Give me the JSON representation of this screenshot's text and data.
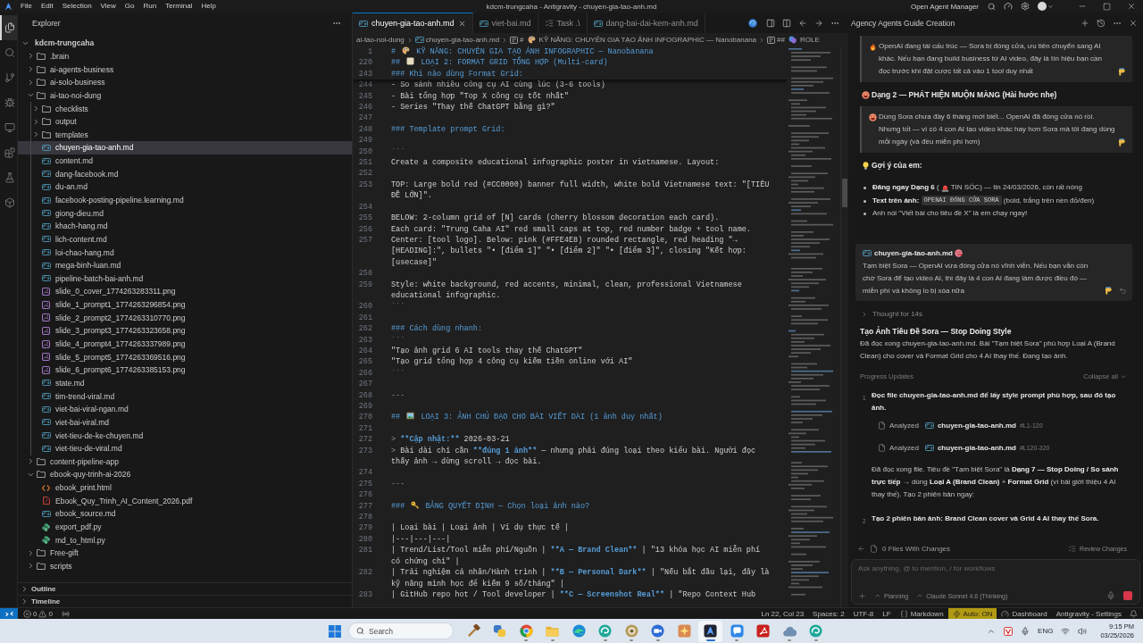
{
  "title_bar": {
    "menu": [
      "File",
      "Edit",
      "Selection",
      "View",
      "Go",
      "Run",
      "Terminal",
      "Help"
    ],
    "title": "kdcm-trungcaha - Antigravity - chuyen-gia-tao-anh.md",
    "agent_manager": "Open Agent Manager"
  },
  "activity_bar": [
    {
      "kind": "files",
      "selected": true
    },
    {
      "kind": "search",
      "selected": false
    },
    {
      "kind": "branch",
      "selected": false
    },
    {
      "kind": "debug",
      "selected": false
    },
    {
      "kind": "remote",
      "selected": false
    },
    {
      "kind": "extensions",
      "selected": false
    },
    {
      "kind": "testing",
      "selected": false
    },
    {
      "kind": "cube",
      "selected": false
    }
  ],
  "explorer": {
    "title": "Explorer",
    "tree": [
      {
        "label": "kdcm-trungcaha",
        "kind": "root",
        "expanded": true,
        "selected": false,
        "children": [
          {
            "label": ".brain",
            "kind": "folder",
            "expanded": false,
            "selected": false
          },
          {
            "label": "ai-agents-business",
            "kind": "folder",
            "expanded": false,
            "selected": false
          },
          {
            "label": "ai-solo-business",
            "kind": "folder",
            "expanded": false,
            "selected": false
          },
          {
            "label": "ai-tao-noi-dung",
            "kind": "folder",
            "expanded": true,
            "selected": false,
            "children": [
              {
                "label": "checklists",
                "kind": "folder",
                "expanded": false,
                "selected": false
              },
              {
                "label": "output",
                "kind": "folder",
                "expanded": false,
                "selected": false
              },
              {
                "label": "templates",
                "kind": "folder",
                "expanded": false,
                "selected": false
              },
              {
                "label": "chuyen-gia-tao-anh.md",
                "kind": "md",
                "selected": true
              },
              {
                "label": "content.md",
                "kind": "md",
                "selected": false
              },
              {
                "label": "dang-facebook.md",
                "kind": "md",
                "selected": false
              },
              {
                "label": "du-an.md",
                "kind": "md",
                "selected": false
              },
              {
                "label": "facebook-posting-pipeline.learning.md",
                "kind": "md",
                "selected": false
              },
              {
                "label": "giong-dieu.md",
                "kind": "md",
                "selected": false
              },
              {
                "label": "khach-hang.md",
                "kind": "md",
                "selected": false
              },
              {
                "label": "lich-content.md",
                "kind": "md",
                "selected": false
              },
              {
                "label": "loi-chao-hang.md",
                "kind": "md",
                "selected": false
              },
              {
                "label": "mega-binh-luan.md",
                "kind": "md",
                "selected": false
              },
              {
                "label": "pipeline-batch-bai-anh.md",
                "kind": "md",
                "selected": false
              },
              {
                "label": "slide_0_cover_1774263283311.png",
                "kind": "image",
                "selected": false
              },
              {
                "label": "slide_1_prompt1_1774263296854.png",
                "kind": "image",
                "selected": false
              },
              {
                "label": "slide_2_prompt2_1774263310770.png",
                "kind": "image",
                "selected": false
              },
              {
                "label": "slide_3_prompt3_1774263323658.png",
                "kind": "image",
                "selected": false
              },
              {
                "label": "slide_4_prompt4_1774263337989.png",
                "kind": "image",
                "selected": false
              },
              {
                "label": "slide_5_prompt5_1774263369516.png",
                "kind": "image",
                "selected": false
              },
              {
                "label": "slide_6_prompt6_1774263385153.png",
                "kind": "image",
                "selected": false
              },
              {
                "label": "state.md",
                "kind": "md",
                "selected": false
              },
              {
                "label": "tim-trend-viral.md",
                "kind": "md",
                "selected": false
              },
              {
                "label": "viet-bai-viral-ngan.md",
                "kind": "md",
                "selected": false
              },
              {
                "label": "viet-bai-viral.md",
                "kind": "md",
                "selected": false
              },
              {
                "label": "viet-tieu-de-ke-chuyen.md",
                "kind": "md",
                "selected": false
              },
              {
                "label": "viet-tieu-de-viral.md",
                "kind": "md",
                "selected": false
              }
            ]
          },
          {
            "label": "content-pipeline-app",
            "kind": "folder",
            "expanded": false,
            "selected": false
          },
          {
            "label": "ebook-quy-trinh-ai-2026",
            "kind": "folder",
            "expanded": true,
            "selected": false,
            "children": [
              {
                "label": "ebook_print.html",
                "kind": "html",
                "selected": false
              },
              {
                "label": "Ebook_Quy_Trinh_AI_Content_2026.pdf",
                "kind": "pdf",
                "selected": false
              },
              {
                "label": "ebook_source.md",
                "kind": "md",
                "selected": false
              },
              {
                "label": "export_pdf.py",
                "kind": "python",
                "selected": false
              },
              {
                "label": "md_to_html.py",
                "kind": "python",
                "selected": false
              }
            ]
          },
          {
            "label": "Free-gift",
            "kind": "folder",
            "expanded": false,
            "selected": false
          },
          {
            "label": "scripts",
            "kind": "folder",
            "expanded": false,
            "selected": false
          }
        ]
      }
    ],
    "sections": [
      {
        "label": "Outline",
        "expanded": false
      },
      {
        "label": "Timeline",
        "expanded": false
      }
    ]
  },
  "editor": {
    "tabs": [
      {
        "label": "chuyen-gia-tao-anh.md",
        "kind": "md",
        "selected": true
      },
      {
        "label": "viet-bai.md",
        "kind": "md",
        "selected": false
      },
      {
        "label": "Task .\\",
        "kind": "task",
        "selected": false
      },
      {
        "label": "dang-bai-dai-kem-anh.md",
        "kind": "md",
        "selected": false
      }
    ],
    "breadcrumb": [
      {
        "kind": "folder",
        "text": "ai-tao-noi-dung"
      },
      {
        "kind": "file",
        "text": "chuyen-gia-tao-anh.md"
      },
      {
        "kind": "heading",
        "marker": "#",
        "emoji": {
          "kind": "palette"
        },
        "text": "KỸ NĂNG: CHUYÊN GIA TẠO ẢNH INFOGRAPHIC — Nanobanana"
      },
      {
        "kind": "heading",
        "marker": "##",
        "emoji": {
          "kind": "masks"
        },
        "text": "ROLE"
      }
    ],
    "sticky_lines": [
      {
        "number": "1",
        "segments": [
          {
            "kind": "heading",
            "text": "# "
          },
          {
            "kind": "palette"
          },
          {
            "kind": "heading",
            "text": " KỸ NĂNG: CHUYÊN GIA TẠO ẢNH INFOGRAPHIC — Nanobanana"
          }
        ]
      },
      {
        "number": "220",
        "segments": [
          {
            "kind": "heading",
            "text": "## "
          },
          {
            "kind": "square"
          },
          {
            "kind": "heading",
            "text": " LOẠI 2: FORMAT GRID TỔNG HỢP (Multi-card)"
          }
        ]
      },
      {
        "number": "243",
        "segments": [
          {
            "kind": "heading",
            "text": "### Khi nào dùng Format Grid:"
          }
        ]
      }
    ],
    "lines": [
      {
        "number": "244",
        "segments": [
          {
            "kind": "plain",
            "text": "- So sánh nhiều công cụ AI cùng lúc (3-6 tools)"
          }
        ]
      },
      {
        "number": "245",
        "segments": [
          {
            "kind": "plain",
            "text": "- Bài tổng hợp \"Top X công cụ tốt nhất\""
          }
        ]
      },
      {
        "number": "246",
        "segments": [
          {
            "kind": "plain",
            "text": "- Series \"Thay thế ChatGPT bằng gì?\""
          }
        ]
      },
      {
        "number": "247"
      },
      {
        "number": "248",
        "segments": [
          {
            "kind": "heading",
            "text": "### Template prompt Grid:"
          }
        ]
      },
      {
        "number": "249"
      },
      {
        "number": "250",
        "segments": [
          {
            "kind": "muted",
            "text": "```"
          }
        ]
      },
      {
        "number": "251",
        "segments": [
          {
            "kind": "plain",
            "text": "Create a composite educational infographic poster in vietnamese. Layout:"
          }
        ]
      },
      {
        "number": "252"
      },
      {
        "number": "253",
        "segments": [
          {
            "kind": "plain",
            "text": "TOP: Large bold red (#CC0000) banner full width, white bold Vietnamese text: \"[TIÊU ĐỀ LỚN]\"."
          }
        ]
      },
      {
        "number": "254"
      },
      {
        "number": "255",
        "segments": [
          {
            "kind": "plain",
            "text": "BELOW: 2-column grid of [N] cards (cherry blossom decoration each card)."
          }
        ]
      },
      {
        "number": "256",
        "segments": [
          {
            "kind": "plain",
            "text": "Each card: \"Trung Caha AI\" red small caps at top, red number badge + tool name."
          }
        ]
      },
      {
        "number": "257",
        "segments": [
          {
            "kind": "plain",
            "text": "Center: [tool logo]. Below: pink (#FFE4E8) rounded rectangle, red heading \"→ [HEADING]:\", bullets \"• [điểm 1]\" \"• [điểm 2]\" \"• [điểm 3]\", closing \"Kết hợp: [usecase]\""
          }
        ]
      },
      {
        "number": "258"
      },
      {
        "number": "259",
        "segments": [
          {
            "kind": "plain",
            "text": "Style: white background, red accents, minimal, clean, professional Vietnamese educational infographic."
          }
        ]
      },
      {
        "number": "260",
        "segments": [
          {
            "kind": "muted",
            "text": "```"
          }
        ]
      },
      {
        "number": "261"
      },
      {
        "number": "262",
        "segments": [
          {
            "kind": "heading",
            "text": "### Cách dùng nhanh:"
          }
        ]
      },
      {
        "number": "263",
        "segments": [
          {
            "kind": "muted",
            "text": "```"
          }
        ]
      },
      {
        "number": "264",
        "segments": [
          {
            "kind": "plain",
            "text": "\"Tạo ảnh grid 6 AI tools thay thế ChatGPT\""
          }
        ]
      },
      {
        "number": "265",
        "segments": [
          {
            "kind": "plain",
            "text": "\"Tạo grid tổng hợp 4 công cụ kiếm tiền online với AI\""
          }
        ]
      },
      {
        "number": "266",
        "segments": [
          {
            "kind": "muted",
            "text": "```"
          }
        ]
      },
      {
        "number": "267"
      },
      {
        "number": "268",
        "segments": [
          {
            "kind": "muted",
            "text": "---"
          }
        ]
      },
      {
        "number": "269"
      },
      {
        "number": "270",
        "segments": [
          {
            "kind": "heading",
            "text": "## "
          },
          {
            "kind": "picture"
          },
          {
            "kind": "heading",
            "text": " LOẠI 3: ẢNH CHỦ ĐẠO CHO BÀI VIẾT DÀI (1 ảnh duy nhất)"
          }
        ]
      },
      {
        "number": "271"
      },
      {
        "number": "272",
        "segments": [
          {
            "kind": "quote",
            "text": "> "
          },
          {
            "kind": "strong",
            "text": "**Cập nhật:**"
          },
          {
            "kind": "plain",
            "text": " 2026-03-21"
          }
        ]
      },
      {
        "number": "273",
        "segments": [
          {
            "kind": "quote",
            "text": "> "
          },
          {
            "kind": "plain",
            "text": "Bài dài chỉ cần "
          },
          {
            "kind": "strong",
            "text": "**đúng 1 ảnh**"
          },
          {
            "kind": "plain",
            "text": " — nhưng phải đúng loại theo kiểu bài. Người đọc thấy ảnh → dừng scroll → đọc bài."
          }
        ]
      },
      {
        "number": "274"
      },
      {
        "number": "275",
        "segments": [
          {
            "kind": "muted",
            "text": "---"
          }
        ]
      },
      {
        "number": "276"
      },
      {
        "number": "277",
        "segments": [
          {
            "kind": "heading",
            "text": "### "
          },
          {
            "kind": "key"
          },
          {
            "kind": "heading",
            "text": " BẢNG QUYẾT ĐỊNH — Chọn loại ảnh nào?"
          }
        ]
      },
      {
        "number": "278"
      },
      {
        "number": "279",
        "segments": [
          {
            "kind": "plain",
            "text": "| Loại bài | Loại ảnh | Ví dụ thực tế |"
          }
        ]
      },
      {
        "number": "280",
        "segments": [
          {
            "kind": "plain",
            "text": "|---|---|---|"
          }
        ]
      },
      {
        "number": "281",
        "segments": [
          {
            "kind": "plain",
            "text": "| Trend/List/Tool miễn phí/Nguồn | "
          },
          {
            "kind": "strong",
            "text": "**A — Brand Clean**"
          },
          {
            "kind": "plain",
            "text": " | \"13 khóa học AI miễn phí có chứng chỉ\" |"
          }
        ]
      },
      {
        "number": "282",
        "segments": [
          {
            "kind": "plain",
            "text": "| Trải nghiệm cá nhân/Hành trình | "
          },
          {
            "kind": "strong",
            "text": "**B — Personal Dark**"
          },
          {
            "kind": "plain",
            "text": " | \"Nếu bắt đầu lại, đây là kỹ năng mình học để kiếm 9 số/tháng\" |"
          }
        ]
      },
      {
        "number": "283",
        "segments": [
          {
            "kind": "plain",
            "text": "| GitHub repo hot / Tool developer | "
          },
          {
            "kind": "strong",
            "text": "**C — Screenshot Real**"
          },
          {
            "kind": "plain",
            "text": " | \"Repo Context Hub"
          }
        ]
      }
    ]
  },
  "agent_panel": {
    "title": "Agency Agents Guide Creation",
    "messages": [
      {
        "kind": "quote",
        "parts": [
          {
            "kind": "fire"
          },
          {
            "kind": "text",
            "text": "OpenAI đang tái cấu trúc — Sora bị đóng cửa, ưu tiên chuyển sang AI khác. Nếu bạn đang build business từ AI video, đây là tín hiệu bạn cần đọc trước khi đặt cược tất cả vào 1 tool duy nhất"
          },
          {
            "kind": "point"
          }
        ]
      },
      {
        "kind": "heading",
        "parts": [
          {
            "kind": "laugh"
          },
          {
            "kind": "text",
            "text": "Dạng 2 — PHÁT HIỆN MUỘN MÀNG (Hài hước nhẹ)"
          }
        ]
      },
      {
        "kind": "quote",
        "parts": [
          {
            "kind": "laugh"
          },
          {
            "kind": "text",
            "text": "Dùng Sora chưa đầy 6 tháng mới biết... OpenAI đã đóng cửa nó rồi. Nhưng tốt — vì có 4 con AI tạo video khác hay hơn Sora mà tôi đang dùng mỗi ngày (và đều miễn phí hơn)"
          },
          {
            "kind": "point"
          }
        ]
      },
      {
        "kind": "heading",
        "parts": [
          {
            "kind": "bulb"
          },
          {
            "kind": "text",
            "text": "Gợi ý của em:"
          }
        ]
      },
      {
        "kind": "bullets",
        "items": [
          {
            "parts": [
              {
                "kind": "text",
                "text": "**Đăng ngay Dạng 6** ("
              },
              {
                "kind": "siren"
              },
              {
                "kind": "text",
                "text": "TIN SỐC) — tin 24/03/2026, còn rất nóng"
              }
            ]
          },
          {
            "parts": [
              {
                "kind": "text",
                "text": "**Text trên ảnh:** "
              },
              {
                "kind": "code",
                "text": "OPENAI ĐÓNG CỬA SORA"
              },
              {
                "kind": "text",
                "text": " (bold, trắng trên nền đỏ/đen)"
              }
            ]
          },
          {
            "parts": [
              {
                "kind": "text",
                "text": "Anh nói \"Viết bài cho tiêu đề X\" là em chạy ngay!"
              }
            ]
          }
        ]
      }
    ],
    "user_message": {
      "parts": [
        {
          "kind": "file",
          "text": "chuyen-gia-tao-anh.md"
        },
        {
          "kind": "hearts"
        },
        {
          "kind": "text",
          "text": "Tạm biệt Sora — OpenAI vừa đóng cửa nó vĩnh viễn. Nếu bạn vẫn còn chờ Sora để tạo video AI, thì đây là 4 con AI đang làm được điều đó — miễn phí và không lo bị xóa nữa"
        },
        {
          "kind": "point"
        }
      ]
    },
    "thought": "Thought for 14s",
    "task_title": "Tạo Ảnh Tiêu Đề Sora — Stop Doing Style",
    "task_summary": "Đã đọc xong chuyen-gia-tao-anh.md. Bài \"Tạm biệt Sora\" phù hợp Loại A (Brand Clean) cho cover và Format Grid cho 4 AI thay thế. Đang tạo ảnh.",
    "progress": {
      "title": "Progress Updates",
      "collapse": "Collapse all",
      "steps": [
        {
          "number": "1",
          "text": "Đọc file chuyen-gia-tao-anh.md để lấy style prompt phù hợp, sau đó tạo ảnh.",
          "actions": [
            {
              "verb": "Analyzed",
              "file": "chuyen-gia-tao-anh.md",
              "range": "#L1-120"
            },
            {
              "verb": "Analyzed",
              "file": "chuyen-gia-tao-anh.md",
              "range": "#L120-320"
            }
          ],
          "note": "Đã đọc xong file. Tiêu đề \"Tạm biệt Sora\" là **Dạng 7 — Stop Doing / So sánh trực tiếp** → dùng **Loại A (Brand Clean)** + **Format Grid** (vì bài giới thiệu 4 AI thay thế). Tạo 2 phiên bản ngay:"
        },
        {
          "number": "2",
          "text": "Tạo 2 phiên bản ảnh: Brand Clean cover và Grid 4 AI thay thế Sora."
        }
      ]
    },
    "changes": {
      "label": "0 Files With Changes",
      "review": "Review Changes"
    },
    "composer": {
      "placeholder": "Ask anything, @ to mention, / for workflows",
      "mode": "Planning",
      "model": "Claude Sonnet 4.6 (Thinking)"
    }
  },
  "status_bar": {
    "errors": "0",
    "warnings": "0",
    "items": [
      {
        "kind": "text",
        "text": "Ln 22, Col 23"
      },
      {
        "kind": "text",
        "text": "Spaces: 2"
      },
      {
        "kind": "text",
        "text": "UTF-8"
      },
      {
        "kind": "text",
        "text": "LF"
      },
      {
        "kind": "language",
        "text": "Markdown"
      },
      {
        "kind": "highlight",
        "text": "Auto: ON"
      },
      {
        "kind": "dashboard",
        "text": "Dashboard"
      },
      {
        "kind": "text",
        "text": "Antigravity - Settings"
      }
    ]
  },
  "taskbar": {
    "search_placeholder": "Search",
    "apps": [
      {
        "kind": "hammer",
        "running": false,
        "selected": false
      },
      {
        "kind": "shapes",
        "running": false,
        "selected": false
      },
      {
        "kind": "ring",
        "running": true,
        "selected": false
      },
      {
        "kind": "folder",
        "running": true,
        "selected": false
      },
      {
        "kind": "wave",
        "running": false,
        "selected": false
      },
      {
        "kind": "swirl",
        "running": true,
        "selected": false
      },
      {
        "kind": "badge",
        "running": true,
        "selected": false
      },
      {
        "kind": "camera",
        "running": true,
        "selected": false
      },
      {
        "kind": "burst",
        "running": false,
        "selected": false
      },
      {
        "kind": "arch",
        "running": true,
        "selected": true
      },
      {
        "kind": "bubble",
        "running": true,
        "selected": false
      },
      {
        "kind": "document",
        "running": false,
        "selected": false
      },
      {
        "kind": "cloud",
        "running": true,
        "selected": false
      },
      {
        "kind": "swirl",
        "running": true,
        "selected": false
      }
    ],
    "language": "ENG",
    "time": "9:15 PM",
    "date": "03/25/2026"
  }
}
